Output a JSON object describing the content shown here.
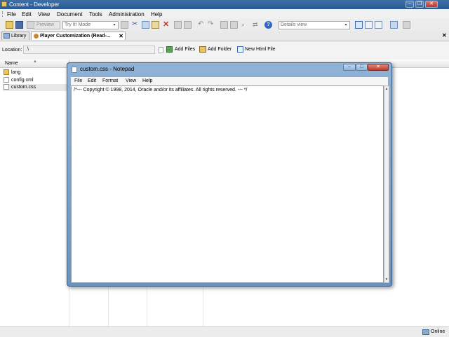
{
  "window": {
    "title": "Content - Developer"
  },
  "menubar": [
    "File",
    "Edit",
    "View",
    "Document",
    "Tools",
    "Administration",
    "Help"
  ],
  "toolbar": {
    "preview_label": "Preview",
    "mode_select": "Try It! Mode",
    "view_select": "Details view"
  },
  "tabs": [
    {
      "label": "Library"
    },
    {
      "label": "Player Customization (Read-..."
    }
  ],
  "location": {
    "label": "Location:",
    "value": ".\\",
    "add_files": "Add Files",
    "add_folder": "Add Folder",
    "new_html": "New Html File"
  },
  "filelist": {
    "column_name": "Name",
    "items": [
      "lang",
      "config.xml",
      "custom.css"
    ]
  },
  "status": {
    "text": "Online"
  },
  "notepad": {
    "title": "custom.css - Notepad",
    "menu": [
      "File",
      "Edit",
      "Format",
      "View",
      "Help"
    ],
    "content": "/*--- Copyright © 1998, 2014, Oracle and/or its affiliates.  All rights reserved. --- */"
  },
  "colors": {
    "titlebar": "#2f5f99",
    "notepad_frame": "#7ea3cb",
    "accent": "#c0392b"
  }
}
